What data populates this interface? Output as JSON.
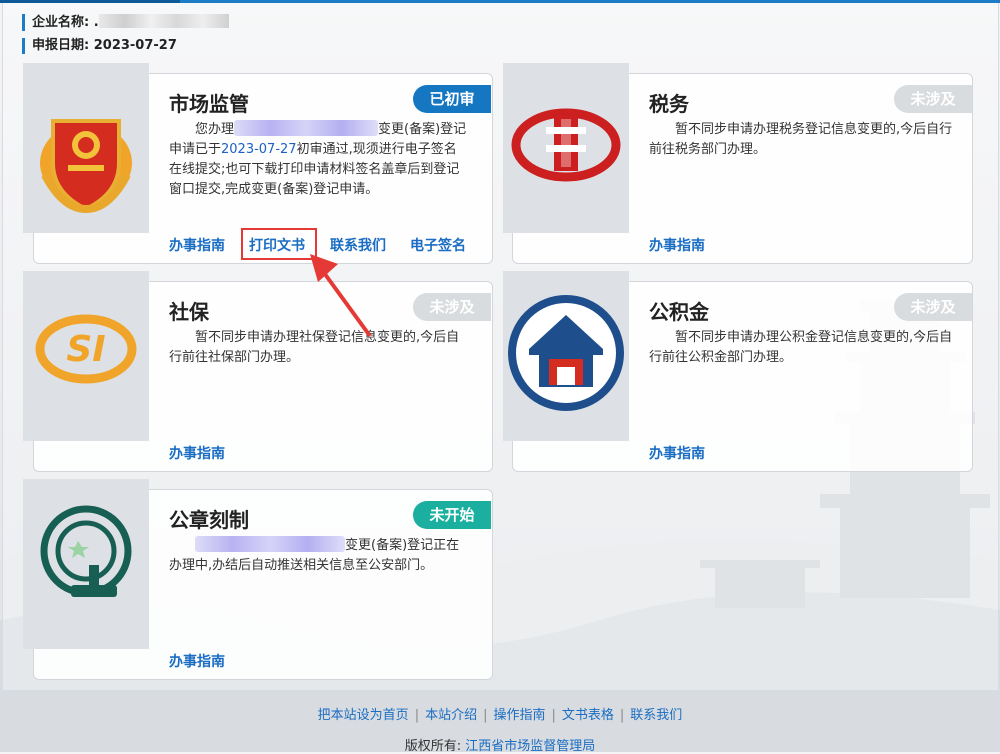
{
  "header": {
    "company_label": "企业名称:",
    "company_value": ".",
    "date_label": "申报日期:",
    "date_value": "2023-07-27"
  },
  "cards": {
    "market": {
      "title": "市场监管",
      "badge": "已初审",
      "desc_a": "您办理",
      "desc_b": "变更(备案)登记申请已于",
      "desc_date": "2023-07-27",
      "desc_c": "初审通过,现须进行电子签名在线提交;也可下载打印申请材料签名盖章后到登记窗口提交,完成变更(备案)登记申请。",
      "links": [
        "办事指南",
        "打印文书",
        "联系我们",
        "电子签名"
      ]
    },
    "tax": {
      "title": "税务",
      "badge": "未涉及",
      "desc": "暂不同步申请办理税务登记信息变更的,今后自行前往税务部门办理。",
      "link": "办事指南"
    },
    "social": {
      "title": "社保",
      "badge": "未涉及",
      "desc": "暂不同步申请办理社保登记信息变更的,今后自行前往社保部门办理。",
      "link": "办事指南"
    },
    "fund": {
      "title": "公积金",
      "badge": "未涉及",
      "desc": "暂不同步申请办理公积金登记信息变更的,今后自行前往公积金部门办理。",
      "link": "办事指南"
    },
    "seal": {
      "title": "公章刻制",
      "badge": "未开始",
      "desc_a": "变更(备案)登记正在办理中,办结后自动推送相关信息至公安部门。",
      "link": "办事指南"
    }
  },
  "footer": {
    "links": [
      "把本站设为首页",
      "本站介绍",
      "操作指南",
      "文书表格",
      "联系我们"
    ],
    "copyright_label": "版权所有:",
    "copyright_owner": "江西省市场监督管理局"
  },
  "colors": {
    "accent": "#1c7cc5",
    "badge_blue": "#1577c2",
    "badge_grey": "#d9dcde",
    "badge_teal": "#1aaf9e",
    "highlight": "#e53935"
  }
}
